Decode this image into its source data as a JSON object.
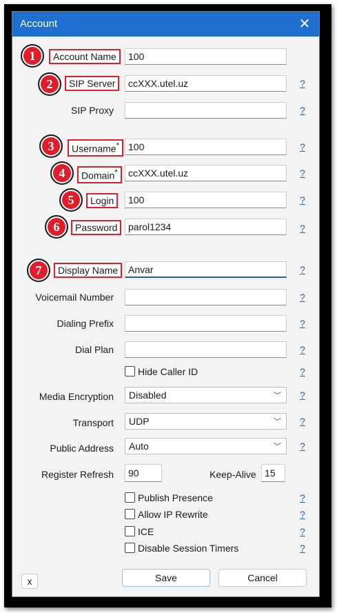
{
  "window": {
    "title": "Account"
  },
  "fields": {
    "account_name": {
      "label": "Account Name",
      "value": "100"
    },
    "sip_server": {
      "label": "SIP Server",
      "value": "ccXXX.utel.uz"
    },
    "sip_proxy": {
      "label": "SIP Proxy",
      "value": ""
    },
    "username": {
      "label": "Username",
      "value": "100"
    },
    "domain": {
      "label": "Domain",
      "value": "ccXXX.utel.uz"
    },
    "login": {
      "label": "Login",
      "value": "100"
    },
    "password": {
      "label": "Password",
      "value": "parol1234"
    },
    "display_name": {
      "label": "Display Name",
      "value": "Anvar"
    },
    "voicemail_number": {
      "label": "Voicemail Number",
      "value": ""
    },
    "dialing_prefix": {
      "label": "Dialing Prefix",
      "value": ""
    },
    "dial_plan": {
      "label": "Dial Plan",
      "value": ""
    },
    "media_encryption": {
      "label": "Media Encryption",
      "value": "Disabled"
    },
    "transport": {
      "label": "Transport",
      "value": "UDP"
    },
    "public_address": {
      "label": "Public Address",
      "value": "Auto"
    },
    "register_refresh": {
      "label": "Register Refresh",
      "value": "90"
    },
    "keep_alive": {
      "label": "Keep-Alive",
      "value": "15"
    }
  },
  "required_mark": "*",
  "checkboxes": {
    "hide_caller_id": "Hide Caller ID",
    "publish_presence": "Publish Presence",
    "allow_ip_rewrite": "Allow IP Rewrite",
    "ice": "ICE",
    "disable_session_timers": "Disable Session Timers"
  },
  "help_text": "?",
  "badges": [
    "1",
    "2",
    "3",
    "4",
    "5",
    "6",
    "7"
  ],
  "buttons": {
    "x": "x",
    "save": "Save",
    "cancel": "Cancel"
  },
  "icons": {
    "close": "close-icon",
    "chevron": "chevron-down-icon"
  },
  "colors": {
    "titlebar": "#1f6fd1",
    "highlight": "#e11d2a",
    "link": "#1f5fb8"
  }
}
